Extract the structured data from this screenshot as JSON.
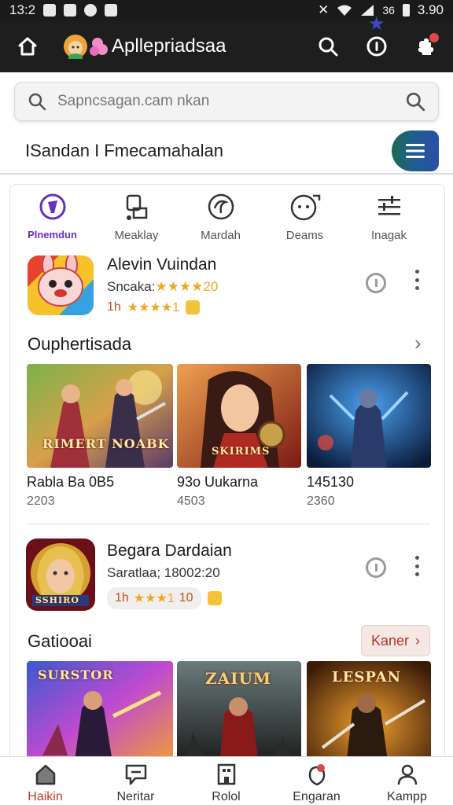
{
  "status_bar": {
    "time": "13:2",
    "right_text": "3.90",
    "carrier": "36"
  },
  "header": {
    "app_title": "Apllepriadsaa"
  },
  "search": {
    "placeholder": "Sapncsagan.cam nkan"
  },
  "breadcrumb": {
    "text": "ISandan I Fmecamahalan"
  },
  "categories": [
    {
      "label": "Plnemdun",
      "icon": "shield-brush-icon",
      "active": true
    },
    {
      "label": "Meaklay",
      "icon": "flag-square-icon",
      "active": false
    },
    {
      "label": "Mardah",
      "icon": "circle-swirl-icon",
      "active": false
    },
    {
      "label": "Deams",
      "icon": "face-circle-icon",
      "active": false
    },
    {
      "label": "Inagak",
      "icon": "sliders-icon",
      "active": false
    }
  ],
  "app1": {
    "name": "Alevin Vuindan",
    "sub_text": "Sncaka:",
    "sub_rating": "★★★★20",
    "meta_prefix": "1h",
    "meta_stars": "★★★★1"
  },
  "section1": {
    "title": "Ouphertisada",
    "tiles": [
      {
        "title": "Rabla Ba 0B5",
        "sub": "2203",
        "art_text": "RIMERT NOABK"
      },
      {
        "title": "93o Uukarna",
        "sub": "4503",
        "art_text": "SKIRIMS"
      },
      {
        "title": "145130",
        "sub": "2360",
        "art_text": ""
      }
    ]
  },
  "app2": {
    "name": "Begara Dardaian",
    "sub_text": "Saratlaa; 18002:20",
    "meta_prefix": "1h",
    "meta_stars": "★★★1",
    "meta_suffix": "10",
    "art_text": "SSHIRO"
  },
  "section2": {
    "title": "Gatiooai",
    "more_label": "Kaner",
    "tiles": [
      {
        "art_text": "SURSTOR"
      },
      {
        "art_text": "ZAIUM"
      },
      {
        "art_text": "LESPAN"
      }
    ]
  },
  "bottom_nav": [
    {
      "label": "Haikin",
      "icon": "home-icon",
      "active": true
    },
    {
      "label": "Neritar",
      "icon": "chat-icon",
      "active": false
    },
    {
      "label": "Rolol",
      "icon": "building-icon",
      "active": false
    },
    {
      "label": "Engaran",
      "icon": "map-pin-icon",
      "active": false
    },
    {
      "label": "Kampp",
      "icon": "person-icon",
      "active": false
    }
  ],
  "colors": {
    "accent_purple": "#6a2ec2",
    "accent_red": "#c03a24",
    "star": "#f0a71e",
    "topbar": "#1e1e1e"
  }
}
